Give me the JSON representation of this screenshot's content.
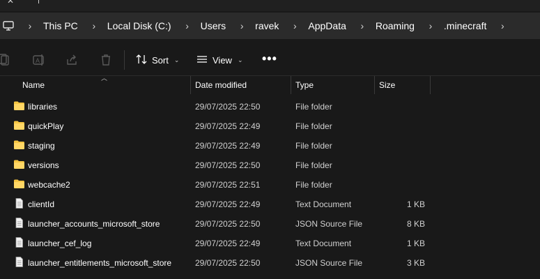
{
  "address_bar": {
    "root_icon": "this-pc-icon",
    "breadcrumbs": [
      "This PC",
      "Local Disk (C:)",
      "Users",
      "ravek",
      "AppData",
      "Roaming",
      ".minecraft"
    ]
  },
  "command_bar": {
    "icons": [
      "copy-icon",
      "rename-icon",
      "share-icon",
      "delete-icon"
    ],
    "sort_label": "Sort",
    "view_label": "View",
    "more_label": "•••"
  },
  "columns": {
    "name": "Name",
    "date_modified": "Date modified",
    "type": "Type",
    "size": "Size"
  },
  "files": [
    {
      "name": "libraries",
      "date": "29/07/2025 22:50",
      "type": "File folder",
      "size": "",
      "icon": "folder-icon"
    },
    {
      "name": "quickPlay",
      "date": "29/07/2025 22:49",
      "type": "File folder",
      "size": "",
      "icon": "folder-icon"
    },
    {
      "name": "staging",
      "date": "29/07/2025 22:49",
      "type": "File folder",
      "size": "",
      "icon": "folder-icon"
    },
    {
      "name": "versions",
      "date": "29/07/2025 22:50",
      "type": "File folder",
      "size": "",
      "icon": "folder-icon"
    },
    {
      "name": "webcache2",
      "date": "29/07/2025 22:51",
      "type": "File folder",
      "size": "",
      "icon": "folder-icon"
    },
    {
      "name": "clientId",
      "date": "29/07/2025 22:49",
      "type": "Text Document",
      "size": "1 KB",
      "icon": "document-icon"
    },
    {
      "name": "launcher_accounts_microsoft_store",
      "date": "29/07/2025 22:50",
      "type": "JSON Source File",
      "size": "8 KB",
      "icon": "document-icon"
    },
    {
      "name": "launcher_cef_log",
      "date": "29/07/2025 22:49",
      "type": "Text Document",
      "size": "1 KB",
      "icon": "document-icon"
    },
    {
      "name": "launcher_entitlements_microsoft_store",
      "date": "29/07/2025 22:50",
      "type": "JSON Source File",
      "size": "3 KB",
      "icon": "document-icon"
    }
  ],
  "colors": {
    "background": "#191919",
    "address_bar": "#2b2b2b",
    "folder": "#f5c542",
    "text": "#ffffff",
    "secondary_text": "#d0d0d0"
  }
}
